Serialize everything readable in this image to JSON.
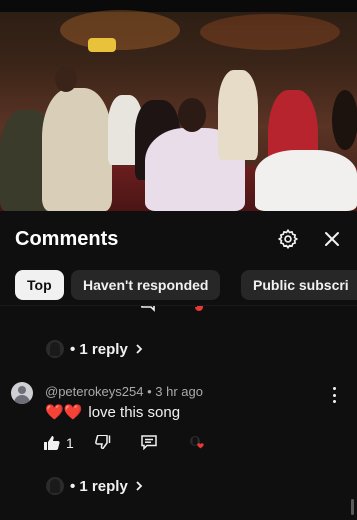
{
  "video": {
    "description_icon": "video-thumbnail"
  },
  "header": {
    "title": "Comments",
    "settings_icon": "gear-icon",
    "close_icon": "close-icon"
  },
  "filters": [
    {
      "label": "Top",
      "active": true
    },
    {
      "label": "Haven't responded",
      "active": false
    },
    {
      "label": "Public subscri",
      "active": false
    }
  ],
  "previous_comment": {
    "replies": "• 1 reply"
  },
  "comment": {
    "author": "@peterokeys254",
    "time": "• 3 hr ago",
    "text": "love this song",
    "emoji": "❤️❤️",
    "like_count": "1",
    "replies": "• 1 reply"
  },
  "colors": {
    "background": "#0f0f0f",
    "chip_active": "#f1f1f1",
    "chip": "#272727",
    "heart": "#e53935",
    "meta": "#aaaaaa"
  }
}
